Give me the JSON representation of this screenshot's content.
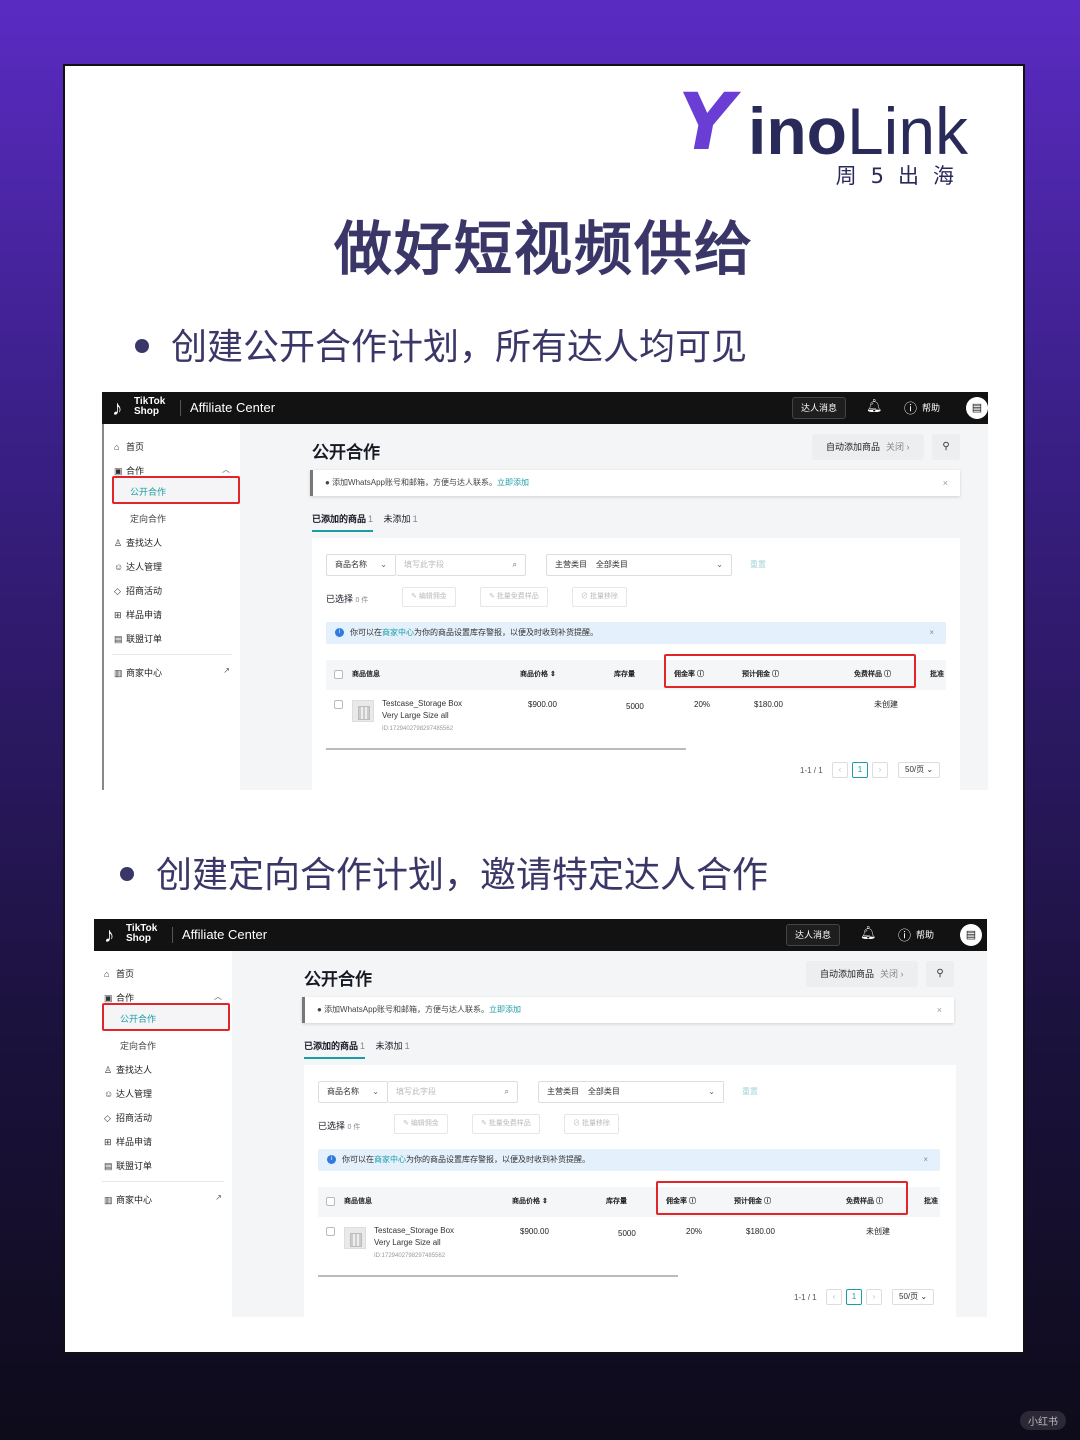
{
  "logo": {
    "y": "Y",
    "ino": "ino",
    "link": "Link",
    "sub": "周5出海"
  },
  "headline": "做好短视频供给",
  "bullets": [
    "创建公开合作计划，所有达人均可见",
    "创建定向合作计划，邀请特定达人合作"
  ],
  "screen": {
    "tiktok_name_line1": "TikTok",
    "tiktok_name_line2": "Shop",
    "app_title": "Affiliate Center",
    "topbar": {
      "messages": "达人消息",
      "help": "帮助",
      "bell_icon": "bell-icon",
      "help_icon": "question-icon"
    },
    "sidebar": {
      "home": "首页",
      "cooperation": "合作",
      "public": "公开合作",
      "targeted": "定向合作",
      "find_creators": "查找达人",
      "creator_mgmt": "达人管理",
      "campaigns": "招商活动",
      "samples": "样品申请",
      "orders": "联盟订单",
      "seller_center": "商家中心"
    },
    "page_title": "公开合作",
    "auto_add": {
      "label": "自动添加商品",
      "state": "关闭 ›"
    },
    "notice": {
      "text": "添加WhatsApp账号和邮箱，方便与达人联系。",
      "link": "立即添加",
      "close": "×"
    },
    "tabs": [
      {
        "label": "已添加的商品",
        "count": "1"
      },
      {
        "label": "未添加",
        "count": "1"
      }
    ],
    "filters": {
      "field": "商品名称",
      "placeholder": "填写此字段",
      "category_label": "主营类目",
      "category_value": "全部类目",
      "reset": "重置"
    },
    "selected": {
      "label": "已选择",
      "count": "0 件"
    },
    "batch": [
      "编辑佣金",
      "批量免费样品",
      "批量移除"
    ],
    "info": {
      "pre": "你可以在",
      "link": "商家中心",
      "post": "为你的商品设置库存警报，以便及时收到补货提醒。",
      "close": "×"
    },
    "columns": {
      "product": "商品信息",
      "price": "商品价格",
      "stock": "库存量",
      "commission": "佣金率",
      "est_commission": "预计佣金",
      "free_sample": "免费样品",
      "approve": "批准"
    },
    "row": {
      "name1": "Testcase_Storage Box",
      "name2": "Very Large Size all",
      "id": "ID:1729402798297485562",
      "price": "$900.00",
      "stock": "5000",
      "commission": "20%",
      "est_commission": "$180.00",
      "free_sample": "未创建"
    },
    "pager": {
      "range": "1-1 / 1",
      "prev": "‹",
      "page": "1",
      "next": "›",
      "size": "50/页 ⌄"
    }
  },
  "watermark": "小红书",
  "colors": {
    "accent": "#1a9da6",
    "highlight": "#e0262b",
    "headline": "#3a3768",
    "logo": "#6a3dd4"
  }
}
